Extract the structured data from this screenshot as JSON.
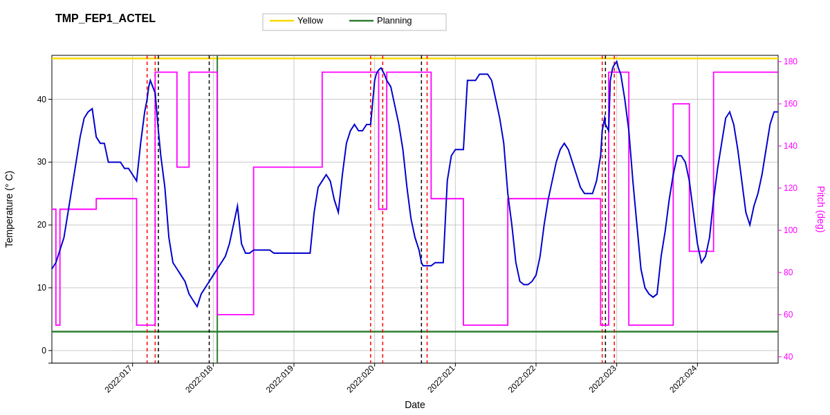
{
  "title": "TMP_FEP1_ACTEL",
  "legend": {
    "yellow_label": "Yellow",
    "planning_label": "Planning",
    "yellow_color": "#FFD700",
    "planning_color": "#2E7D32"
  },
  "axes": {
    "x_label": "Date",
    "y_left_label": "Temperature (° C)",
    "y_right_label": "Pitch (deg)",
    "x_ticks": [
      "2022:017",
      "2022:018",
      "2022:019",
      "2022:020",
      "2022:021",
      "2022:022",
      "2022:023",
      "2022:024"
    ],
    "y_left_ticks": [
      0,
      10,
      20,
      30,
      40
    ],
    "y_right_ticks": [
      40,
      60,
      80,
      100,
      120,
      140,
      160,
      180
    ],
    "y_left_min": -2,
    "y_left_max": 47,
    "y_right_min": 37,
    "y_right_max": 183
  },
  "horizontal_lines": {
    "yellow_y": 46.5,
    "planning_y": 3.0
  },
  "colors": {
    "blue_line": "#0000CD",
    "magenta_line": "#FF00FF",
    "yellow_line": "#FFD700",
    "green_line": "#2E7D32",
    "red_dotted": "#FF0000",
    "black_dotted": "#000000",
    "grid": "#BBBBBB",
    "background": "#FFFFFF"
  }
}
